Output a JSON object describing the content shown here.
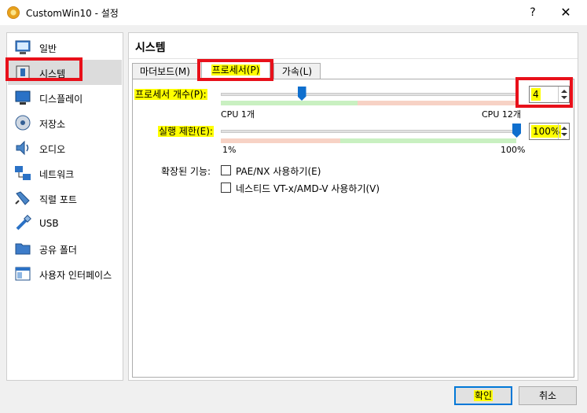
{
  "window": {
    "title": "CustomWin10 - 설정",
    "help": "?",
    "close": "✕"
  },
  "sidebar": {
    "items": [
      {
        "label": "일반",
        "icon": "general-icon"
      },
      {
        "label": "시스템",
        "icon": "system-icon",
        "selected": true
      },
      {
        "label": "디스플레이",
        "icon": "display-icon"
      },
      {
        "label": "저장소",
        "icon": "storage-icon"
      },
      {
        "label": "오디오",
        "icon": "audio-icon"
      },
      {
        "label": "네트워크",
        "icon": "network-icon"
      },
      {
        "label": "직렬 포트",
        "icon": "serial-port-icon"
      },
      {
        "label": "USB",
        "icon": "usb-icon"
      },
      {
        "label": "공유 폴더",
        "icon": "shared-folder-icon"
      },
      {
        "label": "사용자 인터페이스",
        "icon": "user-interface-icon"
      }
    ]
  },
  "main": {
    "title": "시스템",
    "tabs": [
      {
        "label": "마더보드(M)"
      },
      {
        "label": "프로세서(P)",
        "active": true
      },
      {
        "label": "가속(L)"
      }
    ]
  },
  "processor": {
    "count_label": "프로세서 개수(P):",
    "count_value": "4",
    "count_min_label": "CPU 1개",
    "count_max_label": "CPU 12개",
    "count_min": 1,
    "count_max": 12,
    "exec_label": "실행 제한(E):",
    "exec_value": "100%",
    "exec_min_label": "1%",
    "exec_max_label": "100%",
    "exec_percent": 100,
    "ext_label": "확장된 기능:",
    "pae_label": "PAE/NX 사용하기(E)",
    "pae_checked": false,
    "nested_label": "네스티드 VT-x/AMD-V 사용하기(V)",
    "nested_checked": false
  },
  "buttons": {
    "ok": "확인",
    "cancel": "취소"
  },
  "colors": {
    "highlight": "#ffff00",
    "annotation_red": "#e8101a",
    "band_green": "#c9f0c1",
    "band_red": "#f7d2c5",
    "thumb_blue": "#0f6fce"
  }
}
